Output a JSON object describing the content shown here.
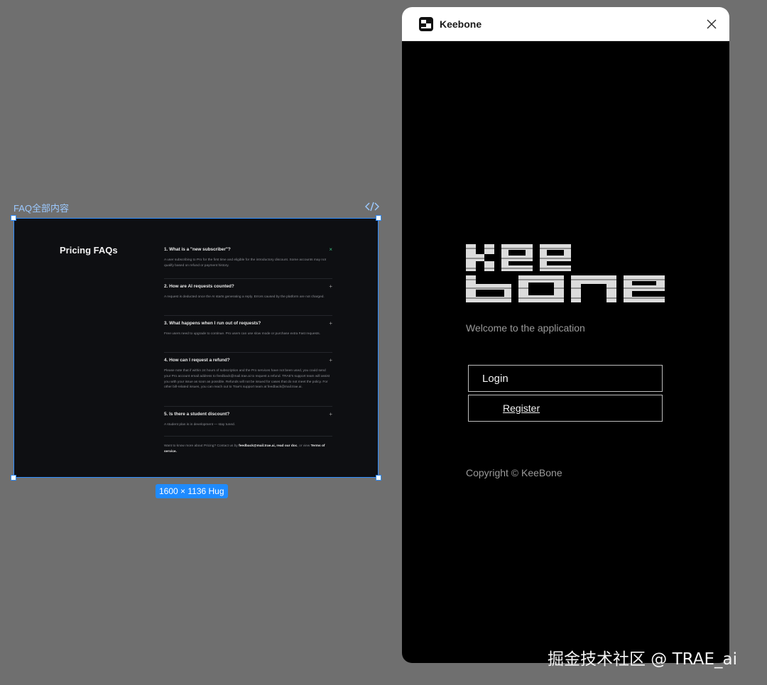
{
  "canvas": {
    "frame_label": "FAQ全部内容",
    "size_badge": "1600 × 1136 Hug",
    "faq": {
      "heading": "Pricing FAQs",
      "items": [
        {
          "question": "1. What is a \"new subscriber\"?",
          "toggle": "×",
          "answer": "A user subscribing to Pro for the first time and eligible for the introductory discount. Some accounts may not qualify based on refund or payment history."
        },
        {
          "question": "2. How are AI requests counted?",
          "toggle": "+",
          "answer": "A request is deducted once the AI starts generating a reply. Errors caused by the platform are not charged."
        },
        {
          "question": "3. What happens when I run out of requests?",
          "toggle": "+",
          "answer": "Free users need to upgrade to continue. Pro users can use slow mode or purchase extra Fast requests."
        },
        {
          "question": "4. How can I request a refund?",
          "toggle": "+",
          "answer": "Please note that if within 24 hours of subscription and the Pro services have not been used, you could send your Pro account email address to feedback@mail.trae.ai to request a refund. TRAE's support team will assist you with your issue as soon as possible. Refunds will not be issued for cases that do not meet the policy. For other bill-related issues, you can reach out to Trae's support team at feedback@mail.trae.ai."
        },
        {
          "question": "5. Is there a student discount?",
          "toggle": "+",
          "answer": "A student plan is in development — stay tuned."
        }
      ],
      "footer_prefix": "Want to know more about Pricing? Contact us by ",
      "footer_email": "feedback@mail.trae.ai",
      "footer_mid": ", read our doc",
      "footer_or": ", or view ",
      "footer_terms": "Terms of service."
    }
  },
  "window": {
    "title": "Keebone",
    "logo_alt": "KeeBone",
    "welcome": "Welcome to the application",
    "login_label": "Login",
    "register_label": "Register",
    "copyright": "Copyright © KeeBone"
  },
  "watermark": "掘金技术社区 @ TRAE_ai",
  "colors": {
    "accent": "#2d8cff",
    "window_bg": "#000000",
    "canvas_bg": "#6f6f6f"
  }
}
